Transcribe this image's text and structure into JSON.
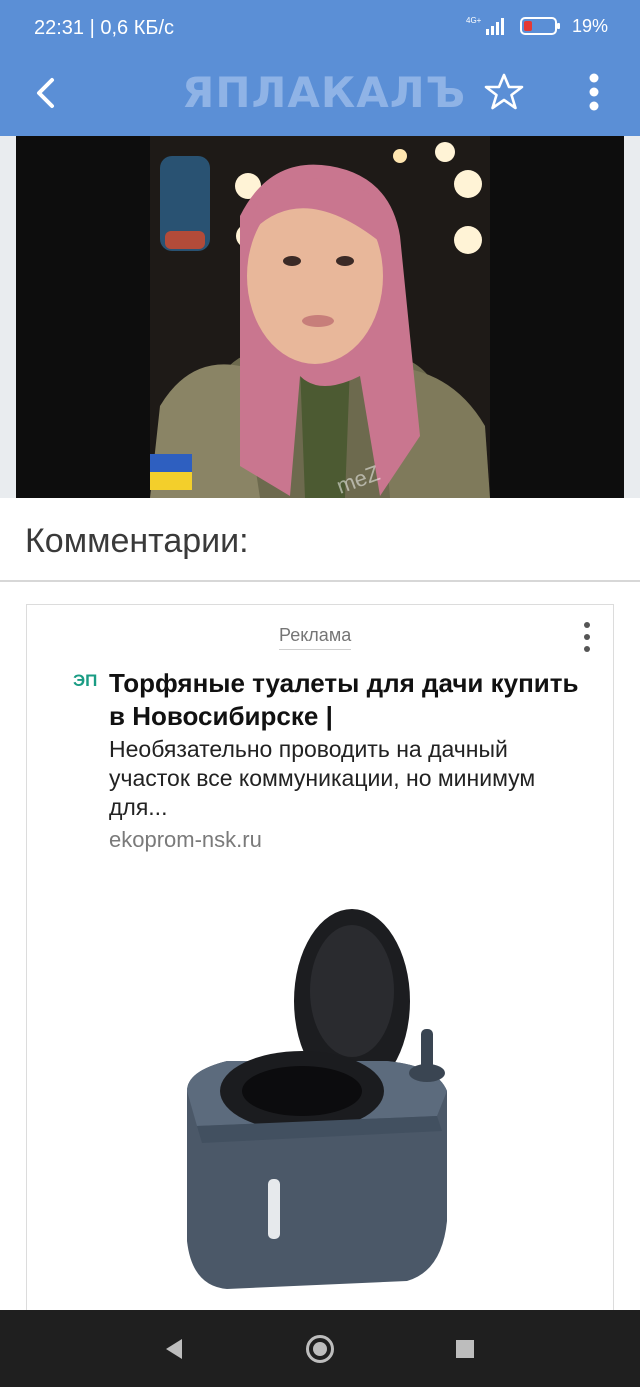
{
  "status_bar": {
    "time_speed": "22:31 | 0,6 КБ/с",
    "network": "4G+",
    "battery_percent": "19%"
  },
  "app_bar": {
    "logo_text": "ЯПЛАКАЛЪ"
  },
  "comments": {
    "title": "Комментарии:"
  },
  "ad": {
    "label": "Реклама",
    "logo": "ЭП",
    "title": "Торфяные туалеты для дачи купить в Новосибирске |",
    "text": "Необязательно проводить на дачный участок все коммуникации, но минимум для...",
    "domain": "ekoprom-nsk.ru"
  },
  "colors": {
    "app_bar": "#5b8fd6",
    "nav_bar": "#1f1f1f",
    "battery_low": "#e53935"
  },
  "icons": {
    "back": "arrow-left-icon",
    "favorite": "star-outline-icon",
    "more": "more-vertical-icon",
    "nav_back": "triangle-back-icon",
    "nav_home": "circle-home-icon",
    "nav_recent": "square-recent-icon"
  }
}
